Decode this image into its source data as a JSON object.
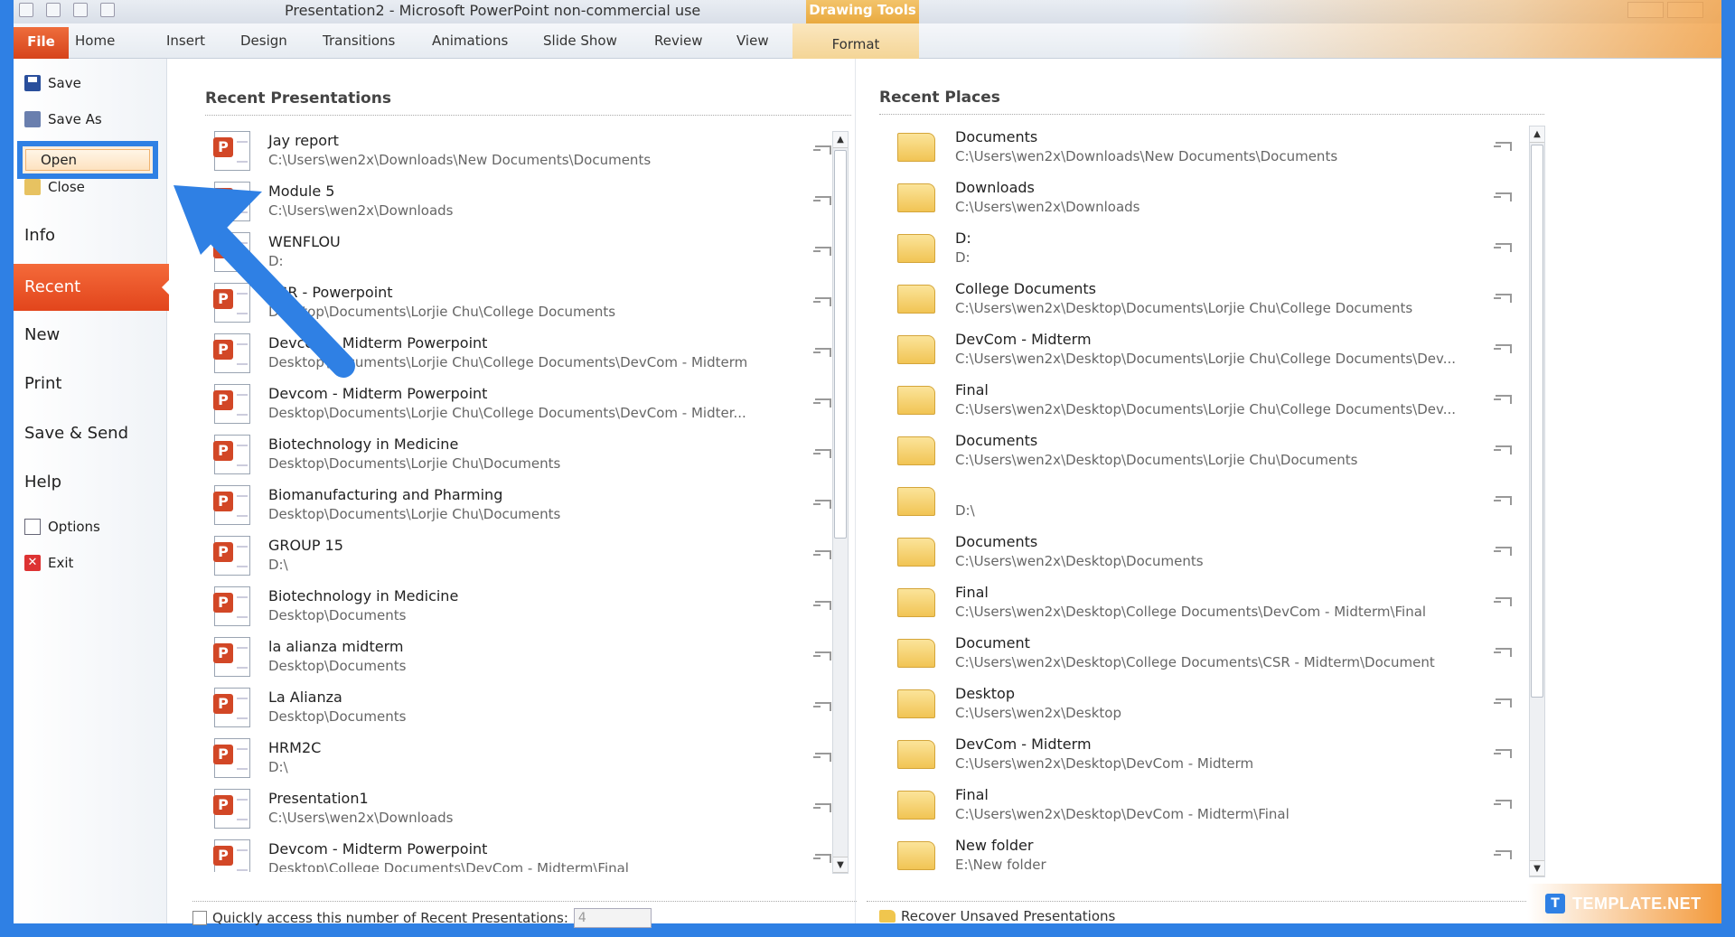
{
  "window": {
    "title": "Presentation2 - Microsoft PowerPoint non-commercial use",
    "context_tab": "Drawing Tools"
  },
  "ribbon": {
    "tabs": [
      "Home",
      "Insert",
      "Design",
      "Transitions",
      "Animations",
      "Slide Show",
      "Review",
      "View"
    ],
    "file_tab": "File",
    "format_tab": "Format"
  },
  "nav": {
    "save": "Save",
    "save_as": "Save As",
    "open": "Open",
    "close": "Close",
    "info": "Info",
    "recent": "Recent",
    "new": "New",
    "print": "Print",
    "save_send": "Save & Send",
    "help": "Help",
    "options": "Options",
    "exit": "Exit"
  },
  "recent_presentations": {
    "title": "Recent Presentations",
    "items": [
      {
        "name": "Jay report",
        "path": "C:\\Users\\wen2x\\Downloads\\New Documents\\Documents"
      },
      {
        "name": "Module 5",
        "path": "C:\\Users\\wen2x\\Downloads"
      },
      {
        "name": "WENFLOU",
        "path": "D:"
      },
      {
        "name": "CSR - Powerpoint",
        "path": "Desktop\\Documents\\Lorjie Chu\\College Documents"
      },
      {
        "name": "Devcom - Midterm Powerpoint",
        "path": "Desktop\\Documents\\Lorjie Chu\\College Documents\\DevCom - Midterm"
      },
      {
        "name": "Devcom - Midterm Powerpoint",
        "path": "Desktop\\Documents\\Lorjie Chu\\College Documents\\DevCom - Midter..."
      },
      {
        "name": "Biotechnology in Medicine",
        "path": "Desktop\\Documents\\Lorjie Chu\\Documents"
      },
      {
        "name": "Biomanufacturing and Pharming",
        "path": "Desktop\\Documents\\Lorjie Chu\\Documents"
      },
      {
        "name": "GROUP 15",
        "path": "D:\\"
      },
      {
        "name": "Biotechnology in Medicine",
        "path": "Desktop\\Documents"
      },
      {
        "name": "la alianza midterm",
        "path": "Desktop\\Documents"
      },
      {
        "name": "La Alianza",
        "path": "Desktop\\Documents"
      },
      {
        "name": "HRM2C",
        "path": "D:\\"
      },
      {
        "name": "Presentation1",
        "path": "C:\\Users\\wen2x\\Downloads"
      },
      {
        "name": "Devcom - Midterm Powerpoint",
        "path": "Desktop\\College Documents\\DevCom - Midterm\\Final"
      }
    ],
    "quick_access_label": "Quickly access this number of Recent Presentations:",
    "quick_access_value": "4"
  },
  "recent_places": {
    "title": "Recent Places",
    "items": [
      {
        "name": "Documents",
        "path": "C:\\Users\\wen2x\\Downloads\\New Documents\\Documents"
      },
      {
        "name": "Downloads",
        "path": "C:\\Users\\wen2x\\Downloads"
      },
      {
        "name": "D:",
        "path": "D:"
      },
      {
        "name": "College Documents",
        "path": "C:\\Users\\wen2x\\Desktop\\Documents\\Lorjie Chu\\College Documents"
      },
      {
        "name": "DevCom - Midterm",
        "path": "C:\\Users\\wen2x\\Desktop\\Documents\\Lorjie Chu\\College Documents\\Dev..."
      },
      {
        "name": "Final",
        "path": "C:\\Users\\wen2x\\Desktop\\Documents\\Lorjie Chu\\College Documents\\Dev..."
      },
      {
        "name": "Documents",
        "path": "C:\\Users\\wen2x\\Desktop\\Documents\\Lorjie Chu\\Documents"
      },
      {
        "name": "",
        "path": "D:\\"
      },
      {
        "name": "Documents",
        "path": "C:\\Users\\wen2x\\Desktop\\Documents"
      },
      {
        "name": "Final",
        "path": "C:\\Users\\wen2x\\Desktop\\College Documents\\DevCom - Midterm\\Final"
      },
      {
        "name": "Document",
        "path": "C:\\Users\\wen2x\\Desktop\\College Documents\\CSR - Midterm\\Document"
      },
      {
        "name": "Desktop",
        "path": "C:\\Users\\wen2x\\Desktop"
      },
      {
        "name": "DevCom - Midterm",
        "path": "C:\\Users\\wen2x\\Desktop\\DevCom - Midterm"
      },
      {
        "name": "Final",
        "path": "C:\\Users\\wen2x\\Desktop\\DevCom - Midterm\\Final"
      },
      {
        "name": "New folder",
        "path": "E:\\New folder"
      }
    ],
    "recover_label": "Recover Unsaved Presentations"
  },
  "watermark": {
    "badge": "T",
    "text": "TEMPLATE.NET"
  },
  "colors": {
    "frame_blue": "#2f80e4",
    "file_orange": "#e2451c",
    "recent_orange": "#f46a3a"
  }
}
